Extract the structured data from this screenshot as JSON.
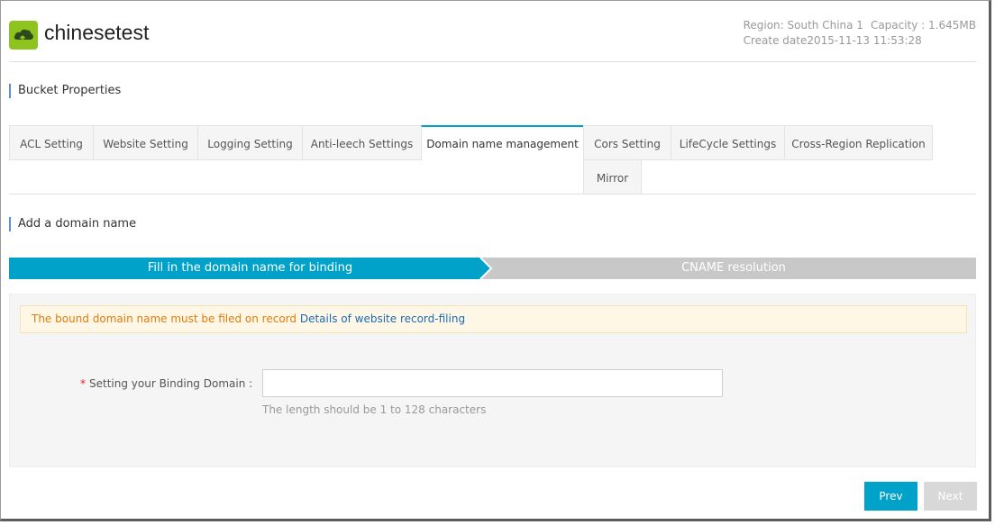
{
  "header": {
    "bucket_name": "chinesetest",
    "region": "Region: South China 1",
    "capacity": "Capacity : 1.645MB",
    "create_date": "Create date2015-11-13 11:53:28"
  },
  "properties_title": "Bucket Properties",
  "tabs": [
    {
      "label": "ACL Setting",
      "active": false
    },
    {
      "label": "Website Setting",
      "active": false
    },
    {
      "label": "Logging Setting",
      "active": false
    },
    {
      "label": "Anti-leech Settings",
      "active": false
    },
    {
      "label": "Domain name management",
      "active": true
    },
    {
      "label": "Cors Setting",
      "active": false
    },
    {
      "label": "LifeCycle Settings",
      "active": false
    },
    {
      "label": "Cross-Region Replication",
      "active": false
    },
    {
      "label": "Mirror",
      "active": false
    }
  ],
  "add_domain_title": "Add a domain name",
  "steps": [
    {
      "label": "Fill in the domain name for binding",
      "active": true
    },
    {
      "label": "CNAME resolution",
      "active": false
    }
  ],
  "notice": {
    "text": "The bound domain name must be filed on record ",
    "link": "Details of website record-filing"
  },
  "form": {
    "required_mark": "*",
    "label": "Setting your Binding Domain :",
    "value": "",
    "placeholder": "",
    "hint": "The length should be 1 to 128 characters"
  },
  "buttons": {
    "prev": "Prev",
    "next": "Next"
  },
  "colors": {
    "accent": "#00a2ca",
    "logo": "#8fc31f",
    "warning_text": "#e07b10",
    "link": "#1c6bb5",
    "inactive_step": "#c8c8c8"
  },
  "icons": {
    "logo": "bucket-cloud-icon"
  }
}
